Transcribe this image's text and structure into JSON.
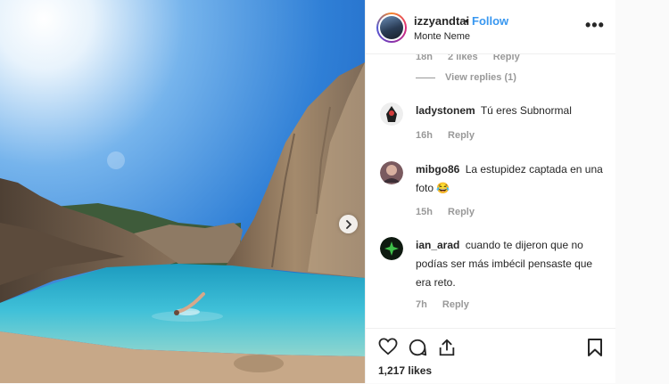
{
  "post": {
    "username": "izzyandtai",
    "separator": "•",
    "follow_label": "Follow",
    "location": "Monte Neme",
    "more_icon": "•••",
    "likes": "1,217 likes"
  },
  "reply_meta": {
    "time": "18h",
    "likes": "2 likes",
    "reply": "Reply",
    "view_replies": "View replies (1)"
  },
  "comments": [
    {
      "user": "ladystonem",
      "text": "Tú eres Subnormal",
      "time": "16h",
      "reply": "Reply"
    },
    {
      "user": "mibgo86",
      "text": "La estupidez captada en una foto 😂",
      "time": "15h",
      "reply": "Reply"
    },
    {
      "user": "ian_arad",
      "text": "cuando te dijeron que no podías ser más imbécil pensaste que era reto.",
      "time": "7h",
      "reply": "Reply"
    }
  ],
  "colors": {
    "accent": "#3897f0",
    "lake": "#2aa7c9",
    "sky": "#3e8fe0"
  }
}
